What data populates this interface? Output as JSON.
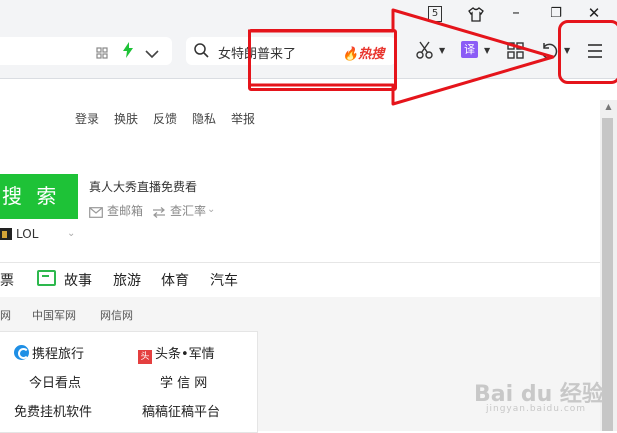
{
  "window": {
    "tab_count": "5",
    "minimize": "–",
    "restore": "❐",
    "close": "✕"
  },
  "toolbar": {
    "search_text": "女特朗普来了",
    "hot_label": "热搜"
  },
  "top_links": [
    "登录",
    "换肤",
    "反馈",
    "隐私",
    "举报"
  ],
  "search": {
    "button_label": "搜 索",
    "promo": "真人大秀直播免费看",
    "mail": "查邮箱",
    "exchange": "查汇率"
  },
  "lol_label": "LOL",
  "categories": {
    "partial": "票",
    "items": [
      "故事",
      "旅游",
      "体育",
      "汽车"
    ]
  },
  "sites": [
    "网",
    "中国军网",
    "网信网"
  ],
  "card": {
    "row1_left": "携程旅行",
    "row1_right": "头条•军情",
    "row1_right_icon": "头",
    "row2_left": "今日看点",
    "row2_right": "学 信 网",
    "row3_left": "免费挂机软件",
    "row3_right": "稿稿征稿平台"
  },
  "watermark": {
    "main": "Bai du 经验",
    "sub": "jingyan.baidu.com"
  },
  "colors": {
    "accent_green": "#1ec237",
    "annotation_red": "#e5141b",
    "hot_red": "#e8352e",
    "translate_purple": "#8b5cf6"
  }
}
